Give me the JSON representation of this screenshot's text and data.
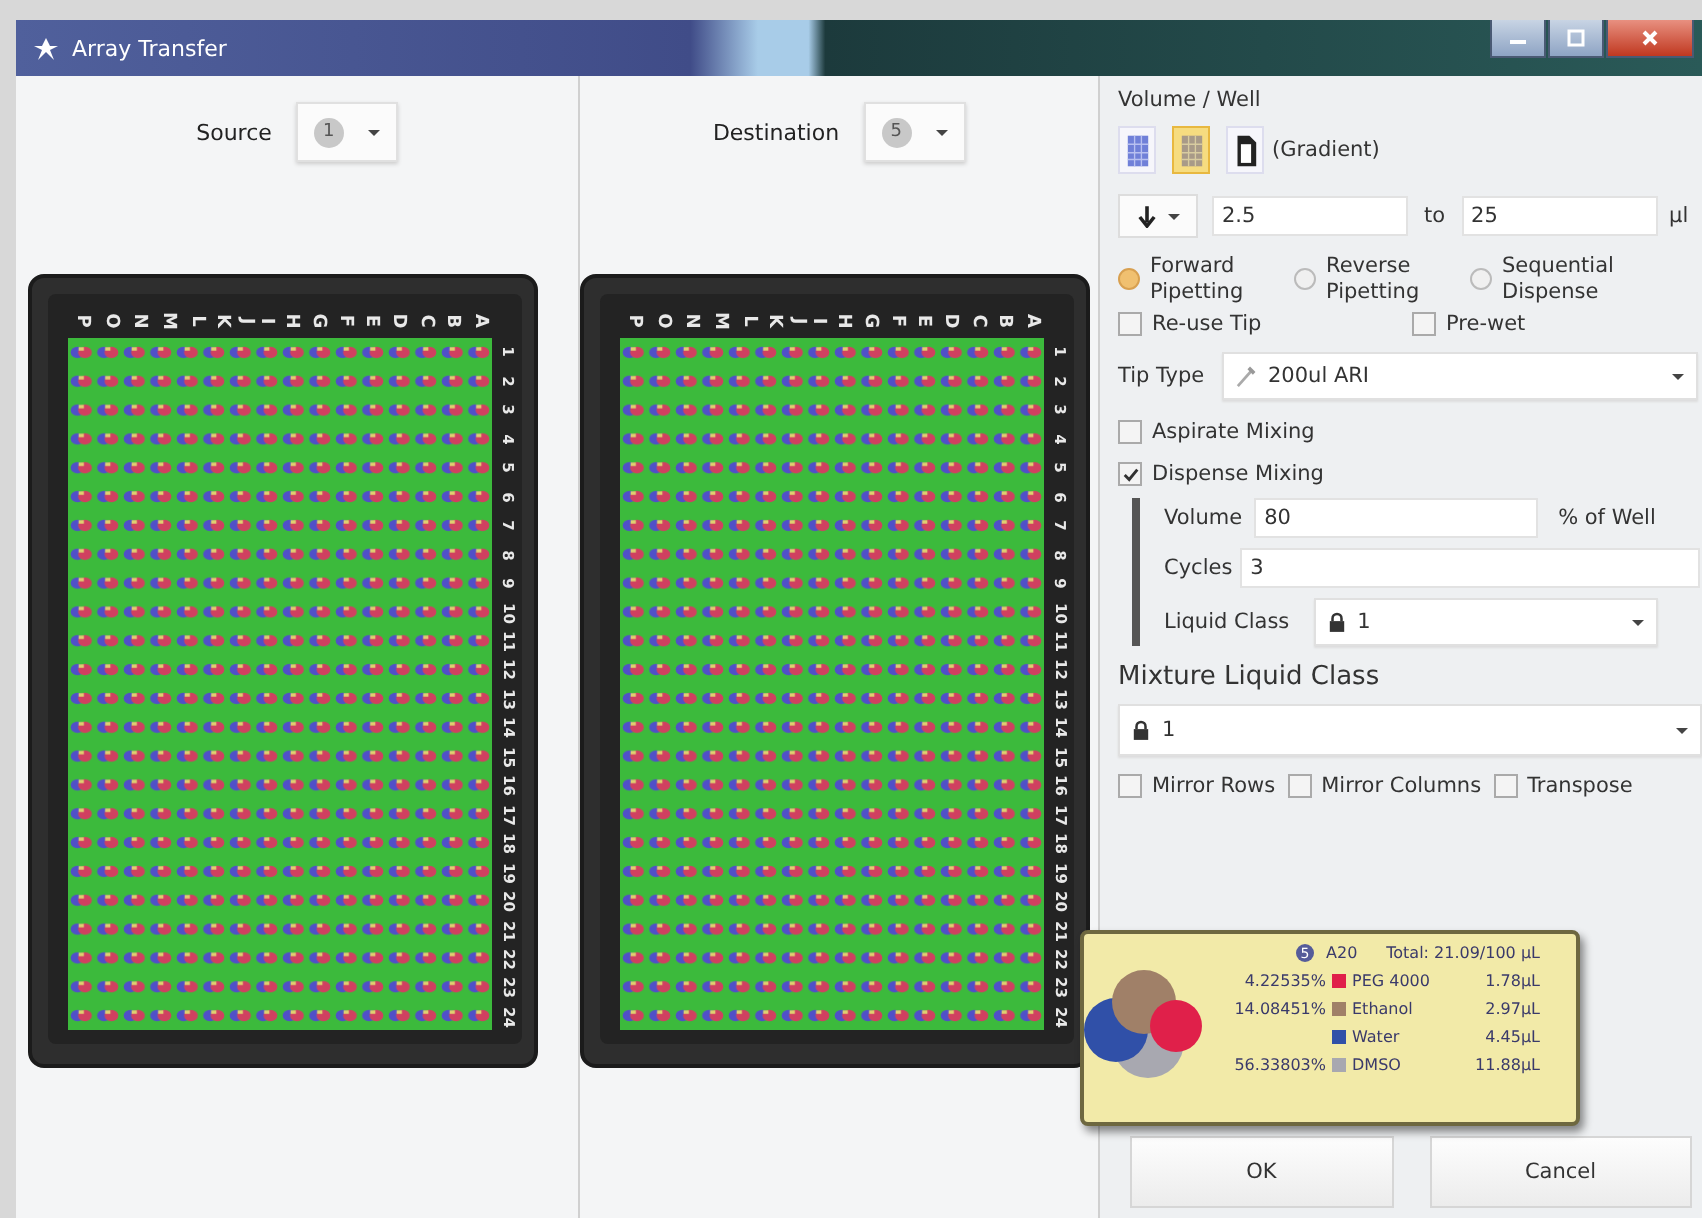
{
  "window": {
    "title": "Array Transfer"
  },
  "source": {
    "label": "Source",
    "plate": "1"
  },
  "destination": {
    "label": "Destination",
    "plate": "5"
  },
  "plates": [
    {
      "columns": [
        "P",
        "O",
        "N",
        "M",
        "L",
        "K",
        "J",
        "I",
        "H",
        "G",
        "F",
        "E",
        "D",
        "C",
        "B",
        "A"
      ],
      "rows": [
        "1",
        "2",
        "3",
        "4",
        "5",
        "6",
        "7",
        "8",
        "9",
        "10",
        "11",
        "12",
        "13",
        "14",
        "15",
        "16",
        "17",
        "18",
        "19",
        "20",
        "21",
        "22",
        "23",
        "24"
      ]
    },
    {
      "columns": [
        "P",
        "O",
        "N",
        "M",
        "L",
        "K",
        "J",
        "I",
        "H",
        "G",
        "F",
        "E",
        "D",
        "C",
        "B",
        "A"
      ],
      "rows": [
        "1",
        "2",
        "3",
        "4",
        "5",
        "6",
        "7",
        "8",
        "9",
        "10",
        "11",
        "12",
        "13",
        "14",
        "15",
        "16",
        "17",
        "18",
        "19",
        "20",
        "21",
        "22",
        "23",
        "24"
      ]
    }
  ],
  "volume": {
    "heading": "Volume / Well",
    "modes": [
      {
        "kind": "columns",
        "selected": false
      },
      {
        "kind": "rows",
        "selected": true
      },
      {
        "kind": "file",
        "selected": false
      }
    ],
    "mode_label": "(Gradient)",
    "from": "2.5",
    "to_label": "to",
    "to": "25",
    "unit": "µl"
  },
  "pipetting": [
    {
      "label": "Forward Pipetting",
      "selected": true
    },
    {
      "label": "Reverse Pipetting",
      "selected": false
    },
    {
      "label": "Sequential Dispense",
      "selected": false
    }
  ],
  "tip_options": [
    {
      "label": "Re-use Tip",
      "checked": false
    },
    {
      "label": "Pre-wet",
      "checked": false
    }
  ],
  "tip_type": {
    "label": "Tip Type",
    "value": "200ul ARI"
  },
  "aspirate_mixing": {
    "label": "Aspirate Mixing",
    "checked": false
  },
  "dispense_mixing": {
    "label": "Dispense Mixing",
    "checked": true,
    "volume_label": "Volume",
    "volume": "80",
    "volume_unit": "% of Well",
    "cycles_label": "Cycles",
    "cycles": "3",
    "liquid_class_label": "Liquid Class",
    "liquid_class": "1"
  },
  "mixture_liquid_class": {
    "label": "Mixture Liquid Class",
    "value": "1"
  },
  "transform_options": [
    {
      "label": "Mirror Rows",
      "checked": false
    },
    {
      "label": "Mirror Columns",
      "checked": false
    },
    {
      "label": "Transpose",
      "checked": false
    }
  ],
  "tooltip": {
    "plate": "5",
    "well": "A20",
    "total": "Total: 21.09/100 µL",
    "components": [
      {
        "percent": "4.22535%",
        "color": "#e0204a",
        "name": "PEG 4000",
        "volume": "1.78µL"
      },
      {
        "percent": "14.08451%",
        "color": "#a08068",
        "name": "Ethanol",
        "volume": "2.97µL"
      },
      {
        "color": "#3050a8",
        "name": "Water",
        "volume": "4.45µL"
      },
      {
        "percent": "56.33803%",
        "color": "#a8a8b0",
        "name": "DMSO",
        "volume": "11.88µL"
      }
    ]
  },
  "buttons": [
    "OK",
    "Cancel"
  ]
}
